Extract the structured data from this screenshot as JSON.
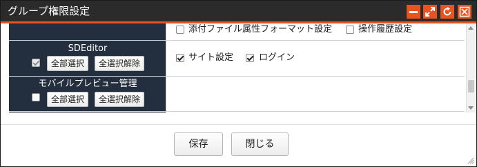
{
  "dialog": {
    "title": "グループ権限設定",
    "title_buttons": [
      "minimize-icon",
      "maximize-icon",
      "refresh-icon",
      "close-icon"
    ]
  },
  "rows": [
    {
      "options": [
        {
          "label": "添付ファイル属性フォーマット設定",
          "checked": false
        },
        {
          "label": "操作履歴設定",
          "checked": false
        }
      ]
    },
    {
      "section": "SDEditor",
      "section_checked": true,
      "select_all": "全部選択",
      "deselect_all": "全選択解除",
      "options": [
        {
          "label": "サイト設定",
          "checked": true
        },
        {
          "label": "ログイン",
          "checked": true
        }
      ]
    },
    {
      "section": "モバイルプレビュー管理",
      "section_checked": false,
      "select_all": "全部選択",
      "deselect_all": "全選択解除",
      "options": []
    }
  ],
  "footer": {
    "save_label": "保存",
    "close_label": "閉じる"
  },
  "colors": {
    "accent": "#e8531f",
    "titlebar": "#2b2b2b",
    "section_bg": "#232f3e"
  }
}
